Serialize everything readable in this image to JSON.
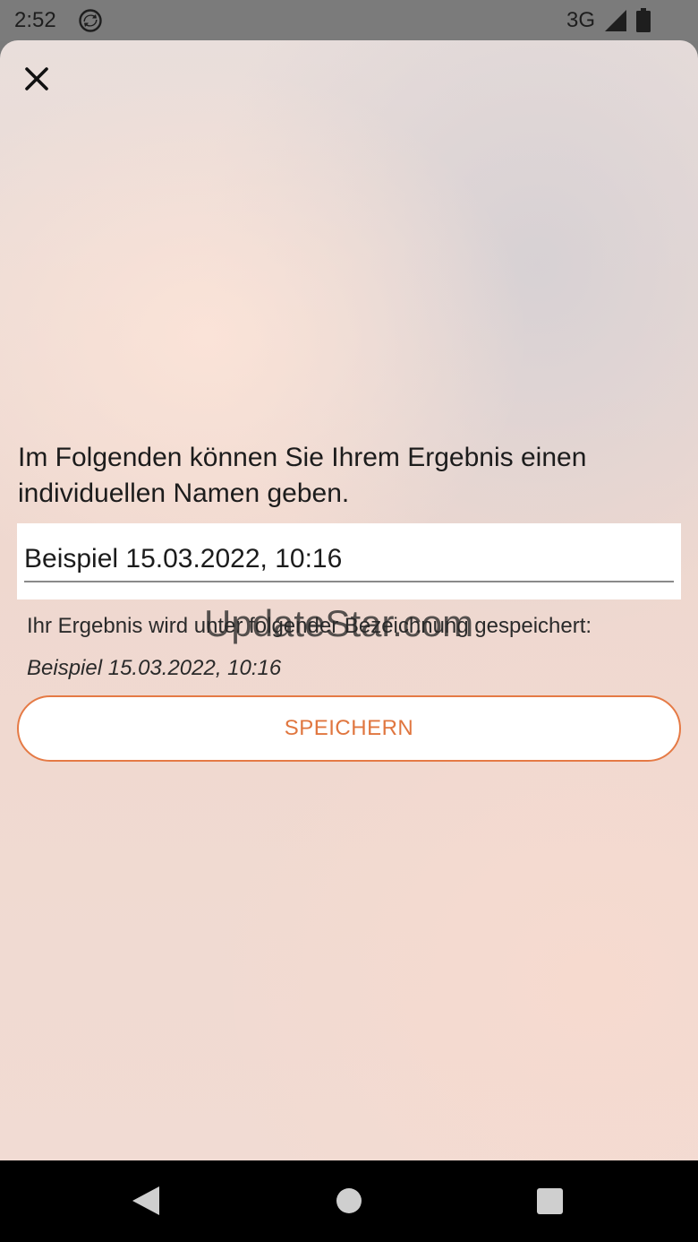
{
  "status_bar": {
    "time": "2:52",
    "network": "3G",
    "icons": [
      "sync-icon",
      "signal-icon",
      "battery-icon"
    ]
  },
  "dialog": {
    "close_icon": "close-icon",
    "intro": "Im Folgenden können Sie Ihrem Ergebnis einen individuellen Namen geben.",
    "name_value": "Beispiel 15.03.2022, 10:16",
    "hint": "Ihr Ergebnis wird unter folgender Bezeichnung gespeichert:",
    "preview": "Beispiel 15.03.2022, 10:16",
    "save_label": "SPEICHERN",
    "accent_color": "#e57a45"
  },
  "watermark": "UpdateStar.com",
  "nav_bar": {
    "icons": [
      "back-icon",
      "home-icon",
      "recents-icon"
    ]
  }
}
